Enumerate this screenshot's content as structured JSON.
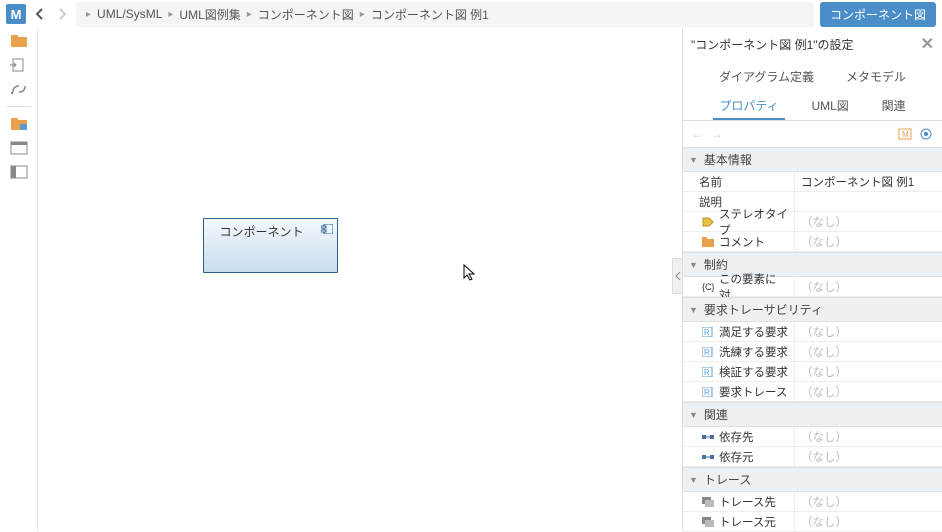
{
  "logo_letter": "M",
  "breadcrumb": {
    "items": [
      "UML/SysML",
      "UML図例集",
      "コンポーネント図",
      "コンポーネント図 例1"
    ]
  },
  "diagram_badge": "コンポーネント図",
  "canvas": {
    "component_label": "コンポーネント"
  },
  "panel": {
    "title": "\"コンポーネント図 例1\"の設定",
    "tabs_row1": [
      "ダイアグラム定義",
      "メタモデル"
    ],
    "tabs_row2": [
      "プロパティ",
      "UML図",
      "関連"
    ],
    "sections": {
      "basic": {
        "header": "基本情報",
        "rows": {
          "name_label": "名前",
          "name_value": "コンポーネント図 例1",
          "desc_label": "説明",
          "stereo_label": "ステレオタイプ",
          "stereo_value": "（なし）",
          "comment_label": "コメント",
          "comment_value": "（なし）"
        }
      },
      "constraint": {
        "header": "制約",
        "rows": {
          "elem_label": "この要素に対…",
          "elem_value": "（なし）"
        }
      },
      "req": {
        "header": "要求トレーサビリティ",
        "rows": {
          "satisfy_label": "満足する要求",
          "satisfy_value": "（なし）",
          "refine_label": "洗練する要求",
          "refine_value": "（なし）",
          "verify_label": "検証する要求",
          "verify_value": "（なし）",
          "trace_label": "要求トレース",
          "trace_value": "（なし）"
        }
      },
      "rel": {
        "header": "関連",
        "rows": {
          "dep_to_label": "依存先",
          "dep_to_value": "（なし）",
          "dep_from_label": "依存元",
          "dep_from_value": "（なし）"
        }
      },
      "trace": {
        "header": "トレース",
        "rows": {
          "trace_to_label": "トレース先",
          "trace_to_value": "（なし）",
          "trace_from_label": "トレース元",
          "trace_from_value": "（なし）"
        }
      }
    }
  }
}
